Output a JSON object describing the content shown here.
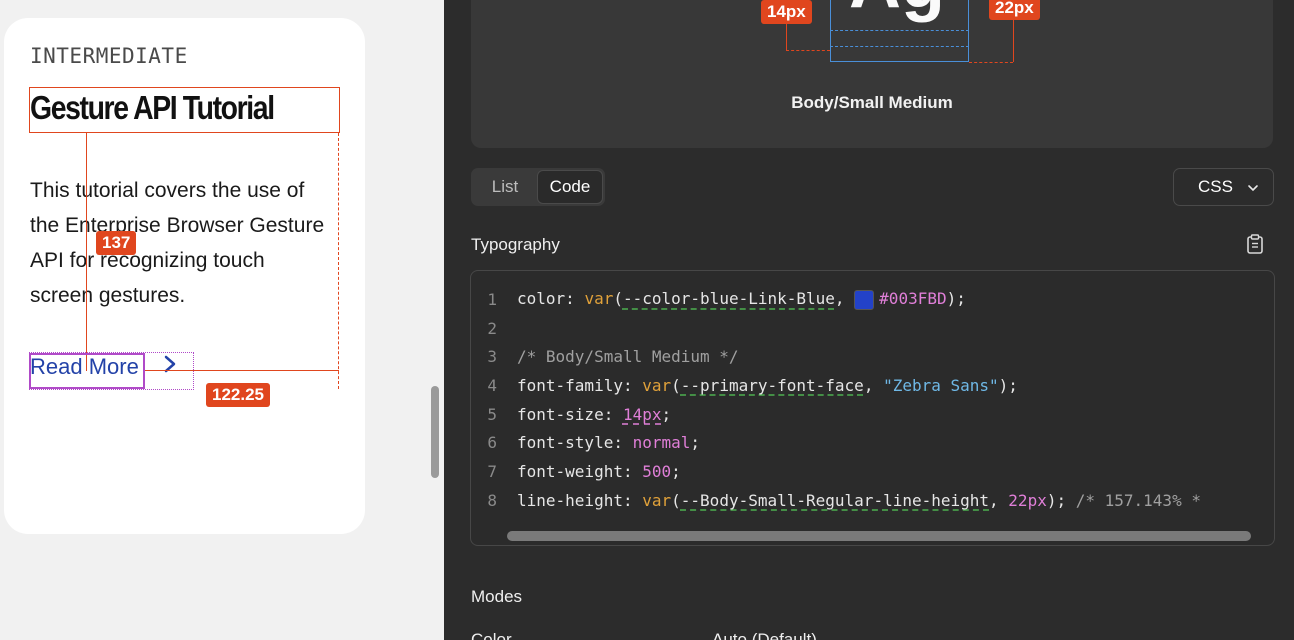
{
  "card": {
    "eyebrow": "INTERMEDIATE",
    "title": "Gesture API Tutorial",
    "body": "This tutorial covers the use of the Enterprise Browser Gesture API for recognizing touch screen gestures.",
    "link_label": "Read More",
    "link_icon": "chevron-right-icon"
  },
  "measure": {
    "height_badge": "137",
    "width_badge": "122.25",
    "font_size_badge": "14px",
    "line_height_badge": "22px"
  },
  "colors": {
    "accent": "#e0461e",
    "link": "#2342a8",
    "swatch": "#003FBD"
  },
  "preview": {
    "glyph": "Ag",
    "label": "Body/Small Medium"
  },
  "tabs": [
    {
      "label": "List",
      "active": false
    },
    {
      "label": "Code",
      "active": true
    }
  ],
  "language": {
    "selected": "CSS",
    "icon": "chevron-down-icon"
  },
  "section": {
    "title": "Typography",
    "copy_icon": "clipboard-icon"
  },
  "code": {
    "line_numbers": [
      "1",
      "2",
      "3",
      "4",
      "5",
      "6",
      "7",
      "8"
    ],
    "l1": {
      "prop": "color",
      "fn": "var",
      "var": "--color-blue-Link-Blue",
      "hex": "#003FBD"
    },
    "l3": {
      "comment": "/* Body/Small Medium */"
    },
    "l4": {
      "prop": "font-family",
      "fn": "var",
      "var": "--primary-font-face",
      "str": "\"Zebra Sans\""
    },
    "l5": {
      "prop": "font-size",
      "val": "14px"
    },
    "l6": {
      "prop": "font-style",
      "val": "normal"
    },
    "l7": {
      "prop": "font-weight",
      "val": "500"
    },
    "l8": {
      "prop": "line-height",
      "fn": "var",
      "var": "--Body-Small-Regular-line-height",
      "val": "22px",
      "comment": "/* 157.143% *"
    }
  },
  "modes": {
    "title": "Modes",
    "row_label": "Color",
    "row_value": "Auto (Default)"
  }
}
